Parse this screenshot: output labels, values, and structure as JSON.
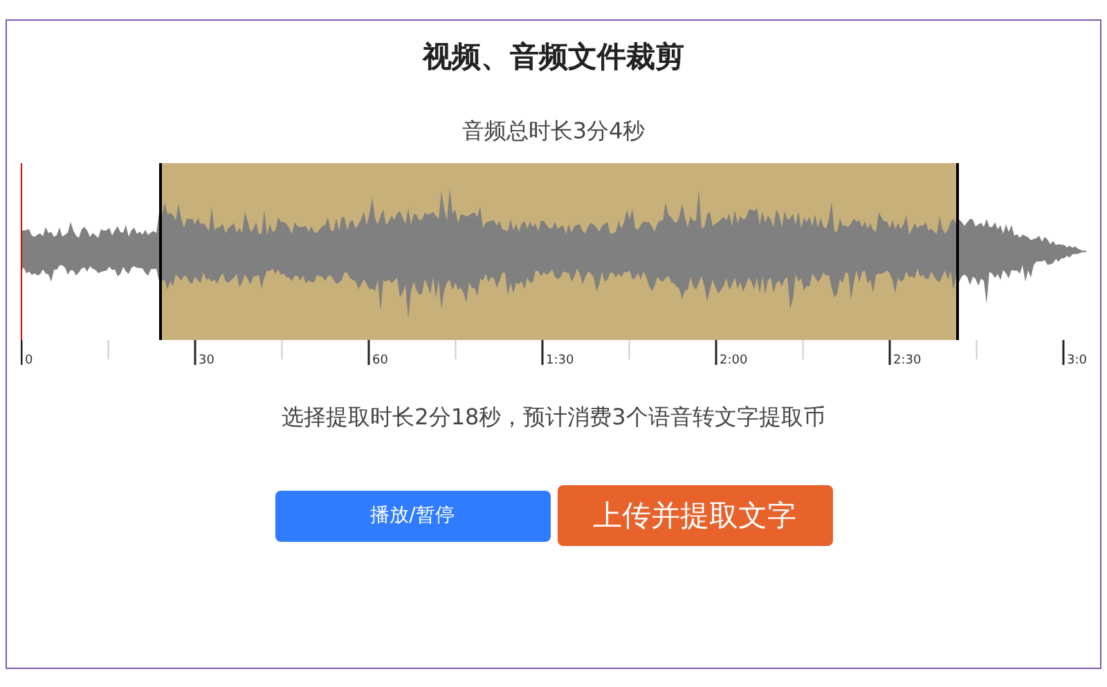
{
  "title": "视频、音频文件裁剪",
  "duration_text": "音频总时长3分4秒",
  "timeline": {
    "labels": [
      "0",
      "30",
      "60",
      "1:30",
      "2:00",
      "2:30",
      "3:0"
    ]
  },
  "selection_text": "选择提取时长2分18秒，预计消费3个语音转文字提取币",
  "buttons": [
    {
      "label": "播放/暂停",
      "kind": "secondary"
    },
    {
      "label": "上传并提取文字",
      "kind": "primary"
    }
  ]
}
